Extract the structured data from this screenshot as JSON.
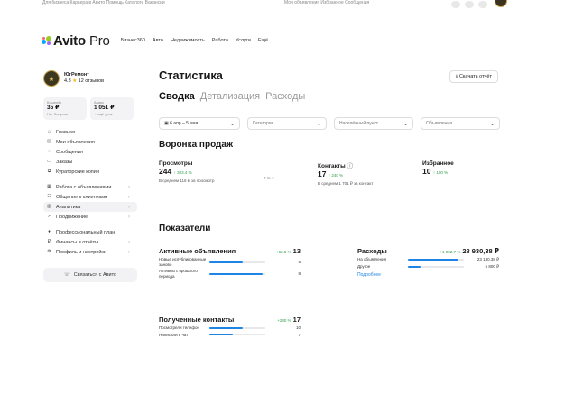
{
  "topstrip": {
    "left_text": "Для бизнеса   Карьера в Авито   Помощь   Каталоги   Вакансии",
    "right_text": "Мои объявления   Избранное   Сообщения"
  },
  "header": {
    "logo_text": "Avito",
    "logo_pro": "Pro",
    "nav": [
      "Бизнес360",
      "Авто",
      "Недвижимость",
      "Работа",
      "Услуги",
      "Ещё"
    ],
    "logo_colors": [
      "#00aaff",
      "#97cf26",
      "#a169f7",
      "#ff6163"
    ]
  },
  "profile": {
    "name": "ЮгРемонт",
    "rating": "4.3",
    "reviews": "12 отзывов"
  },
  "cards": [
    {
      "label": "Кошелёк",
      "value": "35 ₽",
      "sub": "Нет бонусов"
    },
    {
      "label": "Аванс",
      "value": "1 051 ₽",
      "sub": "+ ещё урок"
    }
  ],
  "nav": [
    {
      "label": "Главная",
      "icon": "home-icon",
      "gap": false,
      "chev": false
    },
    {
      "label": "Мои объявления",
      "icon": "listings-icon",
      "gap": false,
      "chev": false
    },
    {
      "label": "Сообщения",
      "icon": "chat-icon",
      "gap": false,
      "chev": false
    },
    {
      "label": "Заказы",
      "icon": "orders-icon",
      "gap": false,
      "chev": false
    },
    {
      "label": "Кураторские копии",
      "icon": "copy-icon",
      "gap": false,
      "chev": false
    },
    {
      "label": "Работа с объявлениями",
      "icon": "work-icon",
      "gap": true,
      "chev": true
    },
    {
      "label": "Общение с клиентами",
      "icon": "clients-icon",
      "gap": false,
      "chev": true
    },
    {
      "label": "Аналитика",
      "icon": "analytics-icon",
      "gap": false,
      "chev": true,
      "active": true
    },
    {
      "label": "Продвижение",
      "icon": "promo-icon",
      "gap": false,
      "chev": true
    },
    {
      "label": "Профессиональный план",
      "icon": "plan-icon",
      "gap": true,
      "chev": false
    },
    {
      "label": "Финансы и отчёты",
      "icon": "finance-icon",
      "gap": false,
      "chev": true
    },
    {
      "label": "Профиль и настройки",
      "icon": "settings-icon",
      "gap": false,
      "chev": true
    }
  ],
  "contact_button": "Связаться с Авито",
  "main": {
    "title": "Статистика",
    "download": "Скачать отчёт",
    "tabs": [
      "Сводка",
      "Детализация",
      "Расходы"
    ],
    "filters": [
      {
        "label": "6 апр – 5 мая",
        "icon": "calendar-icon"
      },
      {
        "label": "Категория"
      },
      {
        "label": "Населённый пункт"
      },
      {
        "label": "Объявления"
      }
    ],
    "funnel_title": "Воронка продаж",
    "funnel": [
      {
        "title": "Просмотры",
        "value": "244",
        "pct": "↑ 303.4 %",
        "sub": "В среднем 116 ₽ за просмотр"
      },
      {
        "title": "Контакты",
        "value": "17",
        "pct": "↑ 240 %",
        "sub": "В среднем 1 701 ₽ за контакт"
      },
      {
        "title": "Избранное",
        "value": "10",
        "pct": "↑ 100 %",
        "sub": ""
      }
    ],
    "funnel_arrow": "7 % >",
    "indicators_title": "Показатели",
    "active_ads": {
      "title": "Активные объявления",
      "pct": "+62.5 %",
      "value": "13",
      "rows": [
        {
          "label": "Новые испубликованные заново",
          "value": "5",
          "fill": 0.6
        },
        {
          "label": "Активны с прошлого периода",
          "value": "8",
          "fill": 0.95
        }
      ]
    },
    "expenses": {
      "title": "Расходы",
      "pct": "+1 902.7 %",
      "value": "28 930,38 ₽",
      "rows": [
        {
          "label": "На объявления",
          "value": "23 130,38 ₽",
          "fill": 0.9
        },
        {
          "label": "Другое",
          "value": "5 800 ₽",
          "fill": 0.22
        }
      ],
      "link": "Подробнее"
    },
    "contacts": {
      "title": "Полученные контакты",
      "pct": "+240 %",
      "value": "17",
      "rows": [
        {
          "label": "Посмотрели телефон",
          "value": "10",
          "fill": 0.6
        },
        {
          "label": "Написали в чат",
          "value": "7",
          "fill": 0.42
        }
      ]
    }
  }
}
